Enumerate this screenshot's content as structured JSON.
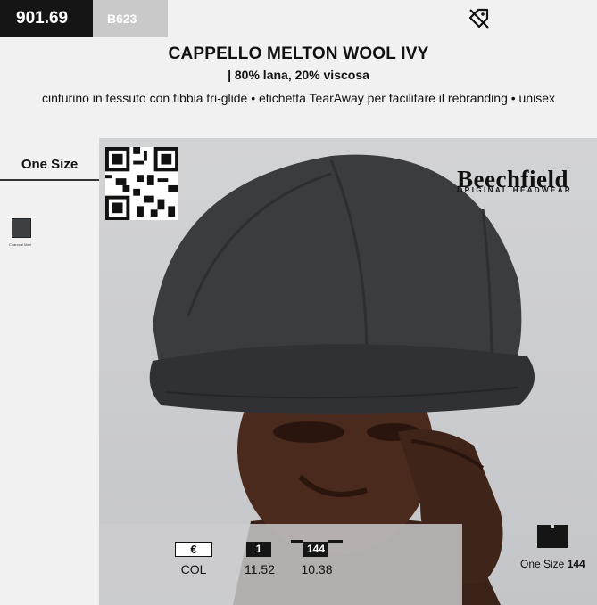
{
  "header": {
    "product_code": "901.69",
    "reference": "B623",
    "title": "CAPPELLO MELTON WOOL IVY",
    "material": "| 80% lana, 20% viscosa",
    "features": "cinturino in tessuto con fibbia tri-glide • etichetta TearAway per facilitare il rebranding • unisex",
    "tag_icon": "price-tag-off-icon"
  },
  "sidebar": {
    "size_label": "One Size",
    "colors": [
      {
        "name": "Charcoal Marl",
        "hex": "#3d4043"
      }
    ]
  },
  "brand": {
    "name": "Beechfield",
    "tagline": "ORIGINAL HEADWEAR"
  },
  "pricing": {
    "currency": "€",
    "col_label": "COL",
    "tiers": [
      {
        "qty": "1",
        "price": "11.52"
      },
      {
        "qty": "144",
        "price": "10.38"
      }
    ]
  },
  "packaging": {
    "size": "One Size",
    "qty": "144"
  },
  "colors": {
    "dark": "#151515",
    "panel": "#f1f1f1",
    "ref_box": "#c9c9c9"
  }
}
